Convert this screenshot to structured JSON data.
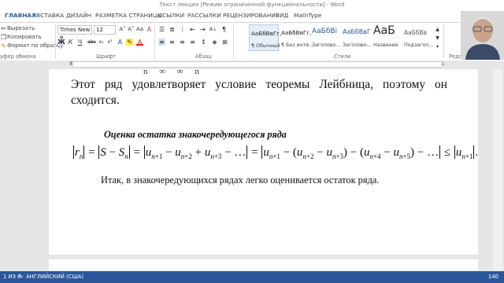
{
  "window": {
    "title": "Текст лекции [Режим ограниченной функциональности] - Word"
  },
  "tabs": [
    "ГЛАВНАЯ",
    "ВСТАВКА",
    "ДИЗАЙН",
    "РАЗМЕТКА СТРАНИЦЫ",
    "ССЫЛКИ",
    "РАССЫЛКИ",
    "РЕЦЕНЗИРОВАНИЕ",
    "ВИД",
    "MathType"
  ],
  "ribbon": {
    "clipboard": {
      "cut": "Вырезать",
      "copy": "Копировать",
      "format_painter": "Формат по образцу",
      "group_label": "уфер обмена"
    },
    "font": {
      "name": "Times New R",
      "size": "12",
      "group_label": "Шрифт"
    },
    "paragraph": {
      "group_label": "Абзац"
    },
    "styles": {
      "group_label": "Стили",
      "items": [
        {
          "preview": "АаБбВвГг,",
          "name": "¶ Обычный"
        },
        {
          "preview": "АаБбВвГг,",
          "name": "¶ Без инте..."
        },
        {
          "preview": "АаБбВі",
          "name": "Заголово..."
        },
        {
          "preview": "АаБбВвГ",
          "name": "Заголово..."
        },
        {
          "preview": "АаБ",
          "name": "Название"
        },
        {
          "preview": "АаБбВв",
          "name": "Подзагол..."
        }
      ]
    },
    "editing": {
      "group_label": "Редактирование"
    }
  },
  "document": {
    "top_partial": "n  ∞  ∞  n",
    "para1": "Этот ряд удовлетворяет условие теоремы Лейбница, поэтому он сходится.",
    "heading": "Оценка остатка знакочередующегося ряда",
    "para2": "Итак, в знакочередующихся рядах легко оценивается остаток ряда."
  },
  "statusbar": {
    "page": "1 ИЗ 6",
    "words": "140",
    "language": "АНГЛИЙСКИЙ (США)"
  },
  "colors": {
    "accent": "#2b579a",
    "statusbar": "#2b579a"
  }
}
